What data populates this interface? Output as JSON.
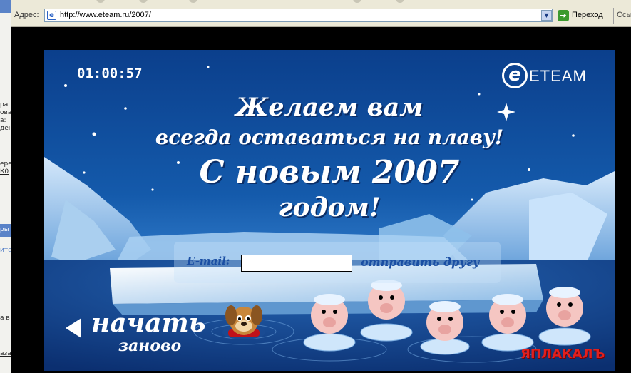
{
  "browser": {
    "address_label": "Адрес:",
    "url": "http://www.eteam.ru/2007/",
    "go_label": "Переход",
    "links_label": "Ссы"
  },
  "left_panel_fragments": [
    "ра",
    "ова",
    "а:",
    "ден",
    "еред",
    "К0",
    "ры",
    "ите",
    "а в",
    "аза"
  ],
  "card": {
    "timer": "01:00:57",
    "logo": "ETEAM",
    "greeting_line1": "Желаем вам",
    "greeting_line2": "всегда оставаться на плаву!",
    "greeting_line3": "С новым 2007",
    "greeting_line4": "годом!",
    "email_label": "E-mail:",
    "email_value": "",
    "send_label": "отправить другу",
    "restart_line1": "начать",
    "restart_line2": "заново"
  },
  "watermark": "ЯПЛАКАЛЪ",
  "colors": {
    "sky": "#0b3f8c",
    "accent_text": "#1a4ea3",
    "watermark_red": "#e0201f"
  }
}
